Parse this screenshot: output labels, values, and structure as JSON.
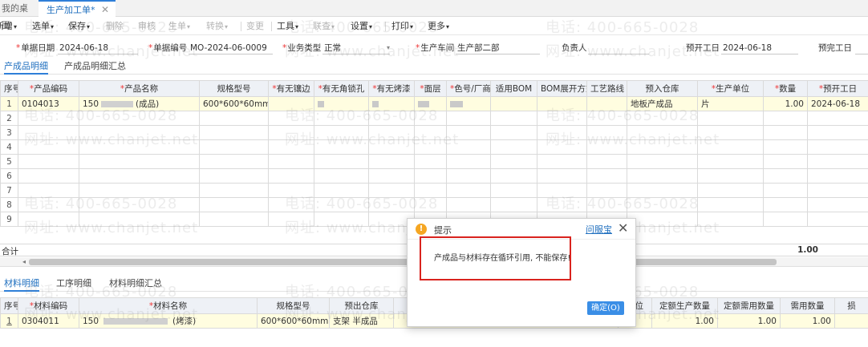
{
  "tabs": {
    "desktop": "我的桌面",
    "active": "生产加工单",
    "active_mark": "*",
    "close": "✕"
  },
  "toolbar": [
    {
      "label": "新增",
      "caret": true,
      "disabled": false
    },
    {
      "label": "选单",
      "caret": true,
      "disabled": false
    },
    {
      "label": "保存",
      "caret": true,
      "disabled": false
    },
    {
      "label": "删除",
      "caret": false,
      "disabled": true
    },
    {
      "label": "审核",
      "caret": false,
      "disabled": true
    },
    {
      "label": "生单",
      "caret": true,
      "disabled": true
    },
    {
      "label": "转换",
      "caret": true,
      "disabled": true
    },
    {
      "label": "变更",
      "caret": false,
      "disabled": true
    },
    {
      "label": "工具",
      "caret": true,
      "disabled": false
    },
    {
      "label": "联查",
      "caret": true,
      "disabled": true
    },
    {
      "label": "设置",
      "caret": true,
      "disabled": false
    },
    {
      "label": "打印",
      "caret": true,
      "disabled": false
    },
    {
      "label": "更多",
      "caret": true,
      "disabled": false
    }
  ],
  "form": {
    "doc_date_label": "单据日期",
    "doc_date": "2024-06-18",
    "doc_no_label": "单据编号",
    "doc_no": "MO-2024-06-0009",
    "biz_type_label": "业务类型",
    "biz_type": "正常",
    "workshop_label": "生产车间",
    "workshop": "生产部二部",
    "owner_label": "负责人",
    "owner": "",
    "plan_start_label": "预开工日",
    "plan_start": "2024-06-18",
    "plan_end_label": "预完工日"
  },
  "top_tabs": [
    "产成品明细",
    "产成品明细汇总"
  ],
  "top_grid": {
    "headers": [
      "序号",
      "产品编码",
      "产品名称",
      "规格型号",
      "有无镶边",
      "有无角锁孔",
      "有无烤漆",
      "面层",
      "色号/厂商",
      "适用BOM",
      "BOM展开方式",
      "工艺路线",
      "预入仓库",
      "生产单位",
      "数量",
      "预开工日"
    ],
    "required": [
      false,
      true,
      true,
      false,
      true,
      true,
      true,
      true,
      true,
      false,
      false,
      false,
      false,
      true,
      true,
      true
    ],
    "row": {
      "no": "1",
      "code": "0104013",
      "name_prefix": "150",
      "name_suffix": "(成品)",
      "spec": "600*600*60mm",
      "warehouse": "地板产成品",
      "unit": "片",
      "qty": "1.00",
      "start": "2024-06-18"
    },
    "empty_rows": [
      "2",
      "3",
      "4",
      "5",
      "6",
      "7",
      "8",
      "9"
    ],
    "total_label": "合计",
    "total_qty": "1.00"
  },
  "bottom_tabs": [
    "材料明细",
    "工序明细",
    "材料明细汇总"
  ],
  "bottom_grid": {
    "headers": [
      "序号",
      "材料编码",
      "材料名称",
      "规格型号",
      "预出仓库",
      "",
      "单位",
      "定额生产数量",
      "定额需用数量",
      "需用数量",
      "损"
    ],
    "required": [
      false,
      true,
      true,
      false,
      false,
      false,
      false,
      false,
      false,
      false,
      false
    ],
    "row": {
      "no": "1",
      "code": "0304011",
      "name_prefix": "150",
      "name_suffix": "(烤漆)",
      "spec": "600*600*60mm",
      "warehouse": "支架 半成品",
      "q1": "1.00",
      "q2": "1.00",
      "q3": "1.00"
    }
  },
  "watermark": {
    "phone": "电话: 400-665-0028",
    "site": "网址: www.chanjet.net"
  },
  "dialog": {
    "icon": "!",
    "title": "提示",
    "help": "问服宝",
    "close": "✕",
    "message": "产成品与材料存在循环引用, 不能保存!",
    "ok": "确定(O)"
  },
  "colors": {
    "accent": "#2f7fd8",
    "selected_row": "#fffde0",
    "warning": "#f5a623",
    "highlight_box": "#d9231e"
  }
}
